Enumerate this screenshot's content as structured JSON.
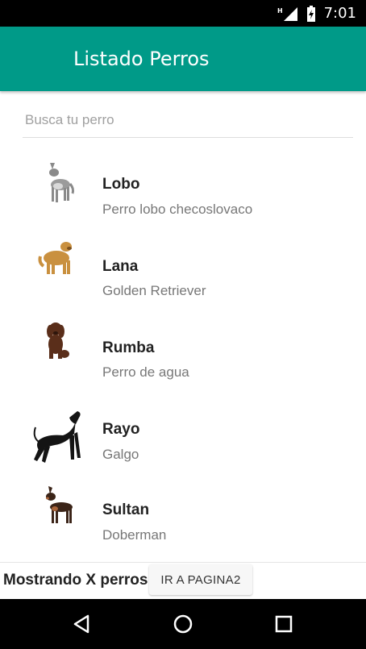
{
  "status_bar": {
    "network": "H",
    "time": "7:01",
    "icons": [
      "signal-icon",
      "battery-icon"
    ]
  },
  "app_bar": {
    "title": "Listado Perros"
  },
  "search": {
    "placeholder": "Busca tu perro",
    "value": ""
  },
  "dogs": [
    {
      "name": "Lobo",
      "breed": "Perro lobo checoslovaco",
      "icon": "wolfdog-image"
    },
    {
      "name": "Lana",
      "breed": "Golden Retriever",
      "icon": "golden-retriever-image"
    },
    {
      "name": "Rumba",
      "breed": "Perro de agua",
      "icon": "water-dog-image"
    },
    {
      "name": "Rayo",
      "breed": "Galgo",
      "icon": "greyhound-image"
    },
    {
      "name": "Sultan",
      "breed": "Doberman",
      "icon": "doberman-image"
    }
  ],
  "footer": {
    "count_label": "Mostrando X perros",
    "button_label": "IR A PAGINA2"
  },
  "nav_bar": {
    "icons": [
      "back-icon",
      "home-icon",
      "recents-icon"
    ]
  },
  "colors": {
    "app_bar": "#009a88",
    "status_bar": "#000000",
    "nav_bar": "#000000"
  }
}
